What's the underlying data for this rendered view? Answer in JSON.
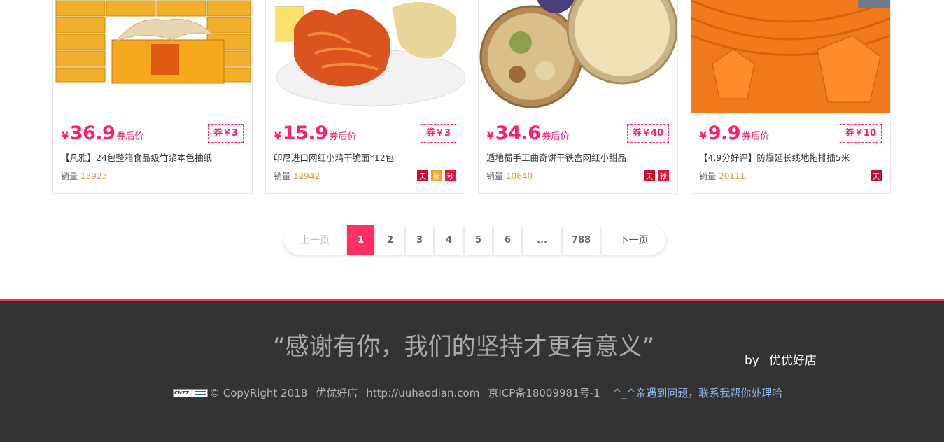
{
  "products": [
    {
      "price": "36.9",
      "currency": "¥",
      "after_label": "券后价",
      "coupon": "券￥3",
      "title": "【凡雅】24包整箱食品级竹浆本色抽纸",
      "sales_label": "销量",
      "sales": "13923",
      "badges": [],
      "image": "tissue-box-image"
    },
    {
      "price": "15.9",
      "currency": "¥",
      "after_label": "券后价",
      "coupon": "券￥3",
      "title": "印尼进口网红小鸡干脆面*12包",
      "sales_label": "销量",
      "sales": "12942",
      "badges": [
        "天",
        "险",
        "秒"
      ],
      "image": "noodles-image"
    },
    {
      "price": "34.6",
      "currency": "¥",
      "after_label": "券后价",
      "coupon": "券￥40",
      "title": "遁地蜀手工曲奇饼干铁盒网红小甜品",
      "sales_label": "销量",
      "sales": "10640",
      "badges": [
        "天",
        "秒"
      ],
      "image": "cookie-tin-image"
    },
    {
      "price": "9.9",
      "currency": "¥",
      "after_label": "券后价",
      "coupon": "券￥10",
      "title": "【4.9分好评】防爆延长线地拖排插5米",
      "sales_label": "销量",
      "sales": "20111",
      "badges": [
        "天"
      ],
      "image": "orange-extension-cord-image"
    }
  ],
  "pagination": {
    "prev": "上一页",
    "pages": [
      "1",
      "2",
      "3",
      "4",
      "5",
      "6",
      "...",
      "788"
    ],
    "current": "1",
    "next": "下一页"
  },
  "footer": {
    "slogan": "“感谢有你，我们的坚持才更有意义”",
    "by": "by",
    "shop": "优优好店",
    "cnzz": "CNZZ",
    "copyright": "© CopyRight 2018",
    "site_name": "优优好店",
    "url": "http://uuhaodian.com",
    "icp": "京ICP备18009981号-1",
    "help": "^_^亲遇到问题，联系我帮你处理哈"
  },
  "colors": {
    "accent": "#ff2e63",
    "price": "#ff1f66",
    "sales_count": "#f5913b",
    "footer_bg": "#333333",
    "help_link": "#8fb6e8"
  }
}
